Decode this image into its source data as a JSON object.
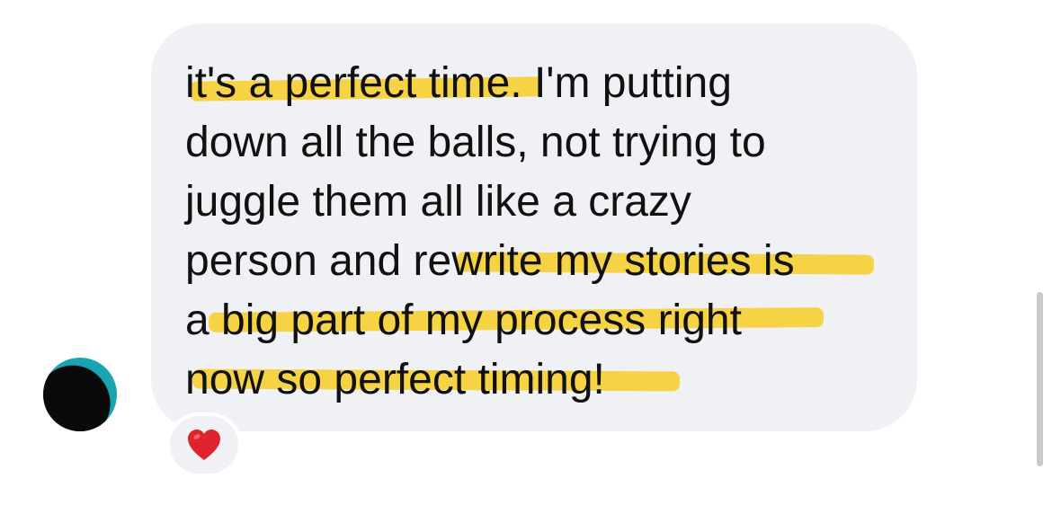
{
  "message": {
    "lines": [
      "it's a perfect time. I'm putting",
      "down all the balls, not trying to",
      "juggle them all like a crazy",
      "person and rewrite my stories is",
      "a big part of my process right",
      "now so perfect timing!"
    ],
    "highlighted_phrases": [
      "it's a perfect tim",
      "rewrite my stories is",
      "big part of my process right",
      "now so perfect timing!"
    ]
  },
  "reaction": {
    "emoji": "heart",
    "icon": "heart-icon"
  },
  "sender": {
    "avatar": "redacted-avatar"
  },
  "colors": {
    "bubble": "#eff1f4",
    "text": "#111111",
    "highlight": "#f7ce26",
    "avatar": "#1aa3b0",
    "heart": "#e0242e",
    "scrollbar": "#c9c9cc"
  }
}
